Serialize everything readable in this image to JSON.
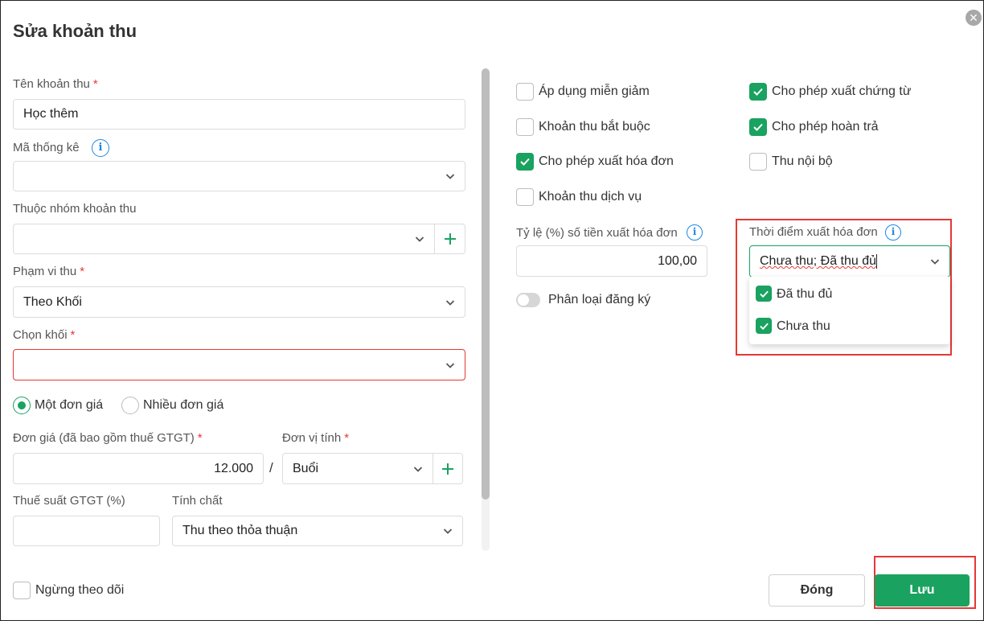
{
  "dialog": {
    "title": "Sửa khoản thu",
    "close_icon": "close-icon"
  },
  "left": {
    "name": {
      "label": "Tên khoản thu",
      "required": "*",
      "value": "Học thêm"
    },
    "stat_code": {
      "label": "Mã thống kê",
      "value": ""
    },
    "group": {
      "label": "Thuộc nhóm khoản thu",
      "value": ""
    },
    "scope": {
      "label": "Phạm vi thu",
      "required": "*",
      "value": "Theo Khối"
    },
    "grade": {
      "label": "Chọn khối",
      "required": "*",
      "value": ""
    },
    "price_mode": {
      "single": "Một đơn giá",
      "multiple": "Nhiều đơn giá",
      "selected": "single"
    },
    "price": {
      "label": "Đơn giá (đã bao gồm thuế GTGT)",
      "required": "*",
      "value": "12.000"
    },
    "slash": "/",
    "unit": {
      "label": "Đơn vị tính",
      "required": "*",
      "value": "Buổi"
    },
    "vat": {
      "label": "Thuế suất GTGT (%)",
      "value": ""
    },
    "nature": {
      "label": "Tính chất",
      "value": "Thu theo thỏa thuận"
    }
  },
  "right": {
    "checkboxes": {
      "exemption": {
        "label": "Áp dụng miễn giảm",
        "checked": false
      },
      "voucher": {
        "label": "Cho phép xuất chứng từ",
        "checked": true
      },
      "mandatory": {
        "label": "Khoản thu bắt buộc",
        "checked": false
      },
      "refund": {
        "label": "Cho phép hoàn trả",
        "checked": true
      },
      "invoice": {
        "label": "Cho phép xuất hóa đơn",
        "checked": true
      },
      "internal": {
        "label": "Thu nội bộ",
        "checked": false
      },
      "service": {
        "label": "Khoản thu dịch vụ",
        "checked": false
      }
    },
    "invoice_ratio": {
      "label": "Tỷ lệ (%) số tiền xuất hóa đơn",
      "value": "100,00"
    },
    "invoice_time": {
      "label": "Thời điểm xuất hóa đơn",
      "value": "Chưa thu; Đã thu đủ",
      "options": [
        {
          "label": "Đã thu đủ",
          "checked": true
        },
        {
          "label": "Chưa thu",
          "checked": true
        }
      ]
    },
    "registration_toggle": {
      "label": "Phân loại đăng ký",
      "on": false
    }
  },
  "footer": {
    "stop_tracking": {
      "label": "Ngừng theo dõi",
      "checked": false
    },
    "close_label": "Đóng",
    "save_label": "Lưu"
  },
  "colors": {
    "accent": "#1aa260",
    "error": "#e53935",
    "info": "#1e88e5"
  }
}
